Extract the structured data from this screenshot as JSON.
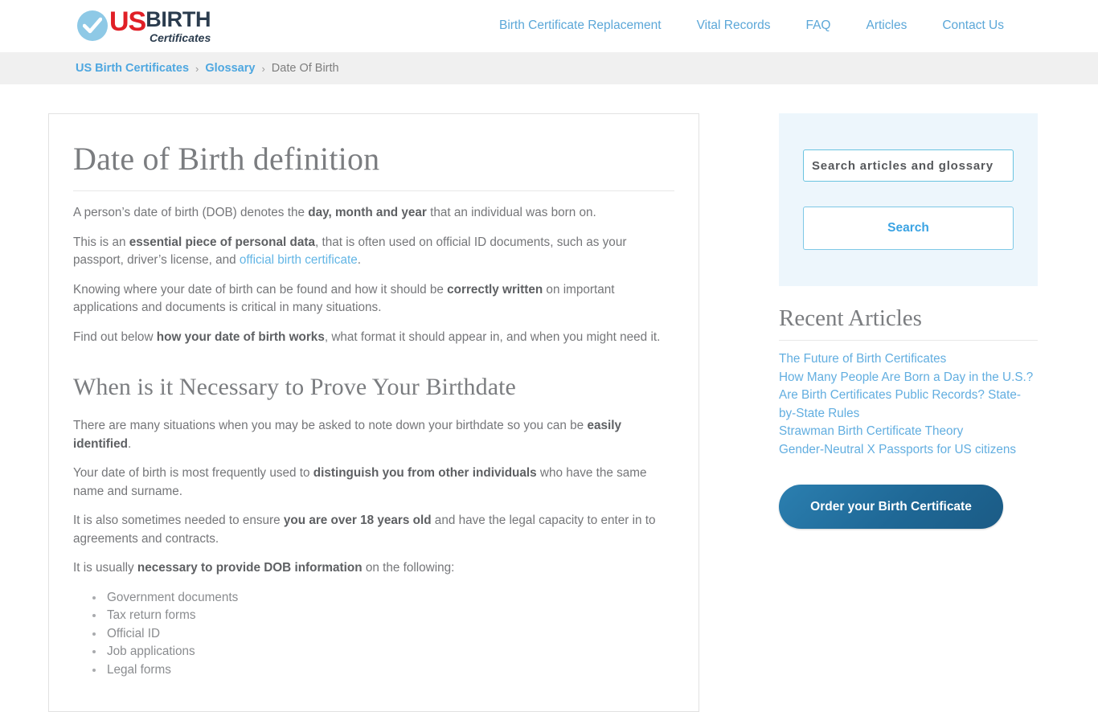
{
  "header": {
    "logo": {
      "check_icon": "check-circle-icon",
      "us": "US",
      "birth": "BIRTH",
      "certificates": "Certificates"
    },
    "nav": [
      {
        "label": "Birth Certificate Replacement"
      },
      {
        "label": "Vital Records"
      },
      {
        "label": "FAQ"
      },
      {
        "label": "Articles"
      },
      {
        "label": "Contact Us"
      }
    ]
  },
  "breadcrumb": {
    "items": [
      {
        "label": "US Birth Certificates",
        "link": true
      },
      {
        "label": "Glossary",
        "link": true
      },
      {
        "label": "Date Of Birth",
        "link": false
      }
    ],
    "separator": "›"
  },
  "main": {
    "title": "Date of Birth definition",
    "paragraphs": [
      {
        "parts": [
          {
            "text": "A person’s date of birth (DOB) denotes the ",
            "style": "normal"
          },
          {
            "text": "day, month and year",
            "style": "bold"
          },
          {
            "text": " that an individual was born on.",
            "style": "normal"
          }
        ]
      },
      {
        "parts": [
          {
            "text": "This is an ",
            "style": "normal"
          },
          {
            "text": "essential piece of personal data",
            "style": "bold"
          },
          {
            "text": ", that is often used on official ID documents, such as your passport, driver’s license, and ",
            "style": "normal"
          },
          {
            "text": "official birth certificate",
            "style": "link"
          },
          {
            "text": ".",
            "style": "normal"
          }
        ]
      },
      {
        "parts": [
          {
            "text": "Knowing where your date of birth can be found and how it should be ",
            "style": "normal"
          },
          {
            "text": "correctly written",
            "style": "bold"
          },
          {
            "text": " on important applications and documents is critical in many situations.",
            "style": "normal"
          }
        ]
      },
      {
        "parts": [
          {
            "text": "Find out below ",
            "style": "normal"
          },
          {
            "text": "how your date of birth works",
            "style": "bold"
          },
          {
            "text": ", what format it should appear in, and when you might need it.",
            "style": "normal"
          }
        ]
      }
    ],
    "section_heading": "When is it Necessary to Prove Your Birthdate",
    "section_paragraphs": [
      {
        "parts": [
          {
            "text": "There are many situations when you may be asked to note down your birthdate so you can be ",
            "style": "normal"
          },
          {
            "text": "easily identified",
            "style": "bold"
          },
          {
            "text": ".",
            "style": "normal"
          }
        ]
      },
      {
        "parts": [
          {
            "text": "Your date of birth is most frequently used to ",
            "style": "normal"
          },
          {
            "text": "distinguish you from other individuals",
            "style": "bold"
          },
          {
            "text": " who have the same name and surname.",
            "style": "normal"
          }
        ]
      },
      {
        "parts": [
          {
            "text": "It is also sometimes needed to ensure ",
            "style": "normal"
          },
          {
            "text": "you are over 18 years old",
            "style": "bold"
          },
          {
            "text": " and have the legal capacity to enter in to agreements and contracts.",
            "style": "normal"
          }
        ]
      },
      {
        "parts": [
          {
            "text": "It is usually ",
            "style": "normal"
          },
          {
            "text": "necessary to provide DOB information",
            "style": "bold"
          },
          {
            "text": " on the following:",
            "style": "normal"
          }
        ]
      }
    ],
    "list_items": [
      "Government documents",
      "Tax return forms",
      "Official ID",
      "Job applications",
      "Legal forms"
    ]
  },
  "sidebar": {
    "search": {
      "placeholder": "Search articles and glossary",
      "value": "",
      "button_label": "Search"
    },
    "recent_articles_title": "Recent Articles",
    "recent_articles": [
      "The Future of Birth Certificates",
      "How Many People Are Born a Day in the U.S.?",
      "Are Birth Certificates Public Records? State-by-State Rules",
      "Strawman Birth Certificate Theory",
      "Gender-Neutral X Passports for US citizens"
    ],
    "order_button_label": "Order your Birth Certificate"
  },
  "colors": {
    "brand_red": "#e01f26",
    "brand_navy": "#2b3c4e",
    "link_blue": "#5ba7d8",
    "panel_blue": "#edf6fc",
    "cta_blue": "#1f6896"
  }
}
